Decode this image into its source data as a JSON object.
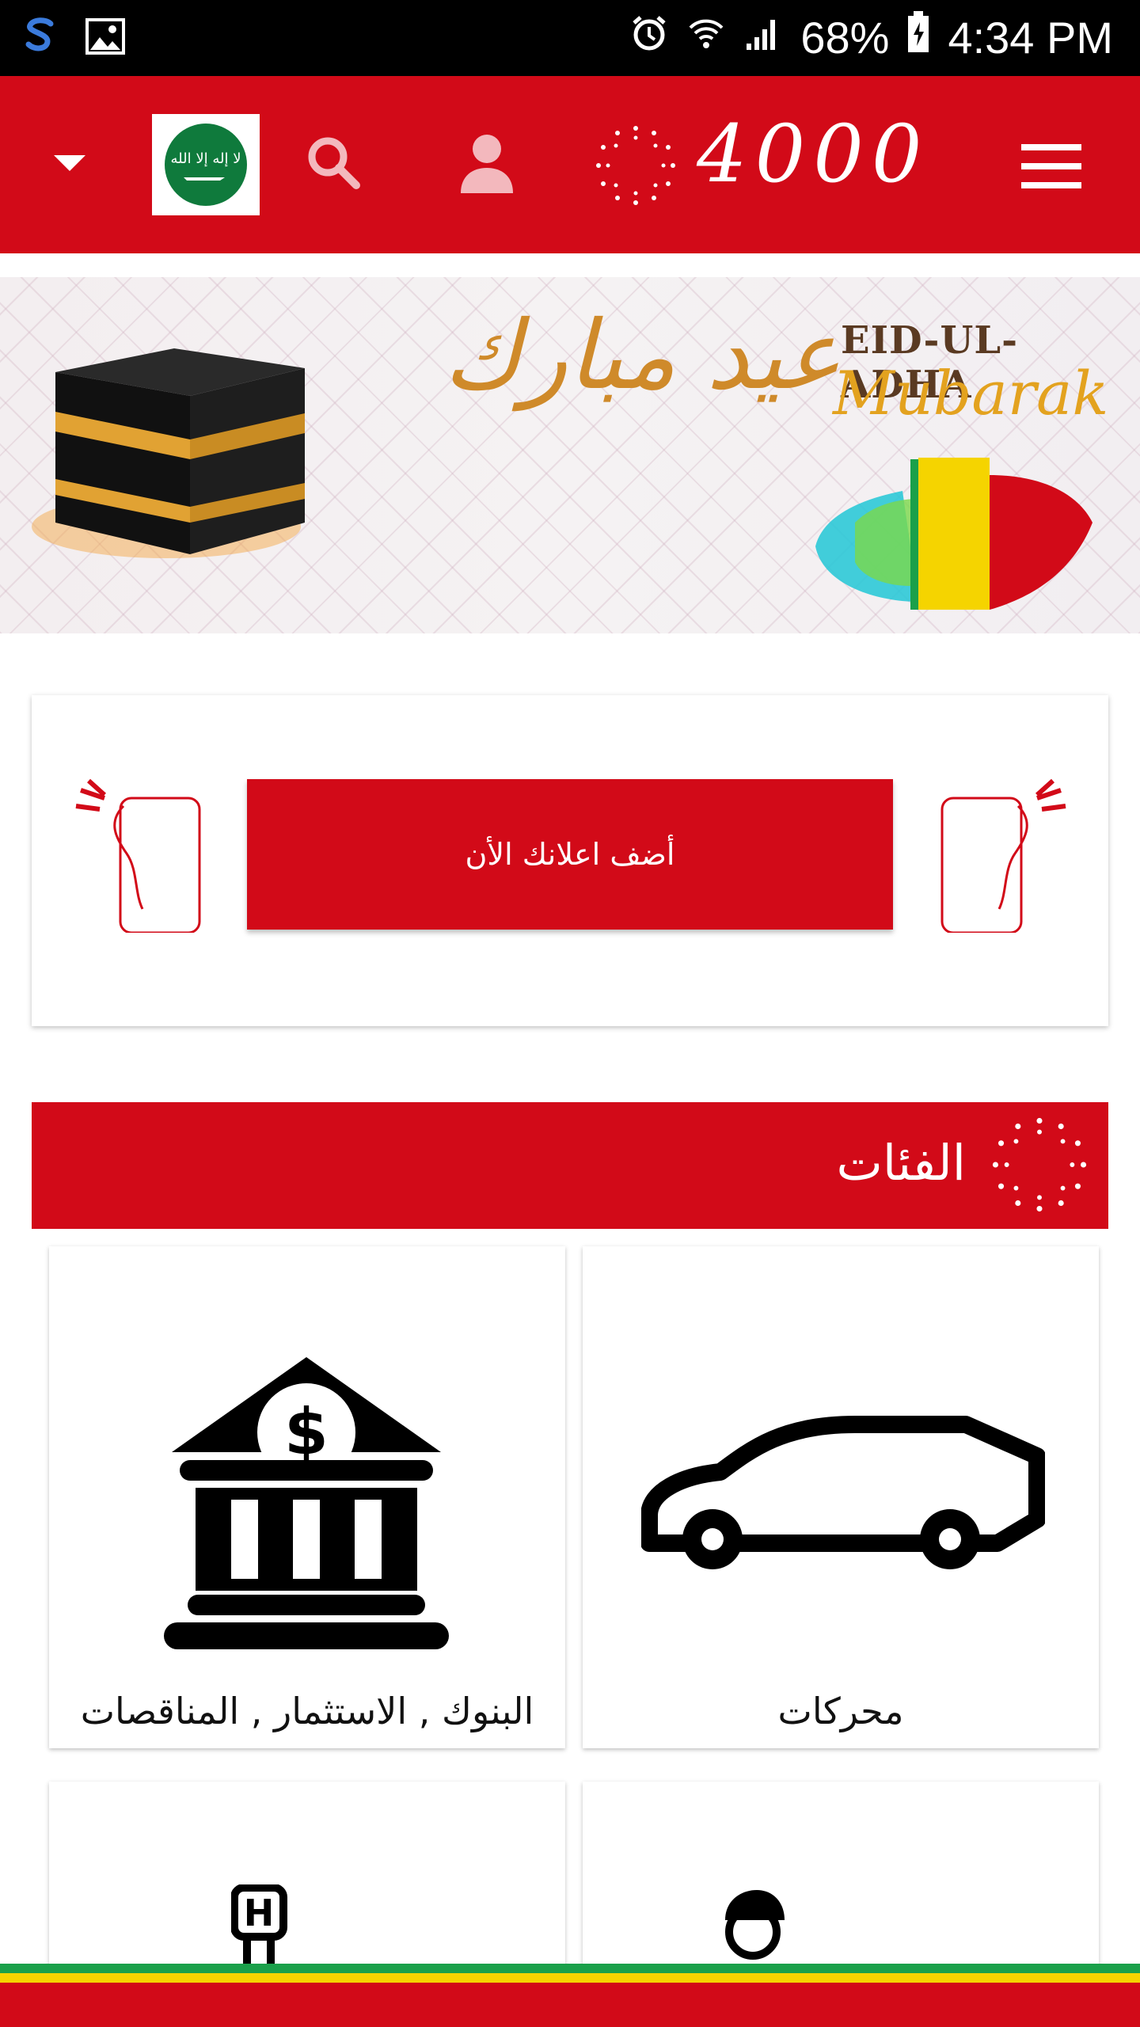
{
  "status_bar": {
    "battery": "68%",
    "time": "4:34 PM"
  },
  "header": {
    "logo_text": "4000"
  },
  "banner": {
    "title_line1": "EID-UL-ADHA",
    "title_line2": "Mubarak",
    "arabic_calligraphy": "عيد مبارك"
  },
  "cta": {
    "button_label": "أضف اعلانك الأن"
  },
  "categories": {
    "title": "الفئات",
    "items": [
      {
        "label": "محركات",
        "icon": "car-icon"
      },
      {
        "label": "البنوك , الاستثمار , المناقصات",
        "icon": "bank-icon"
      }
    ]
  },
  "colors": {
    "brand_red": "#d20a18"
  }
}
